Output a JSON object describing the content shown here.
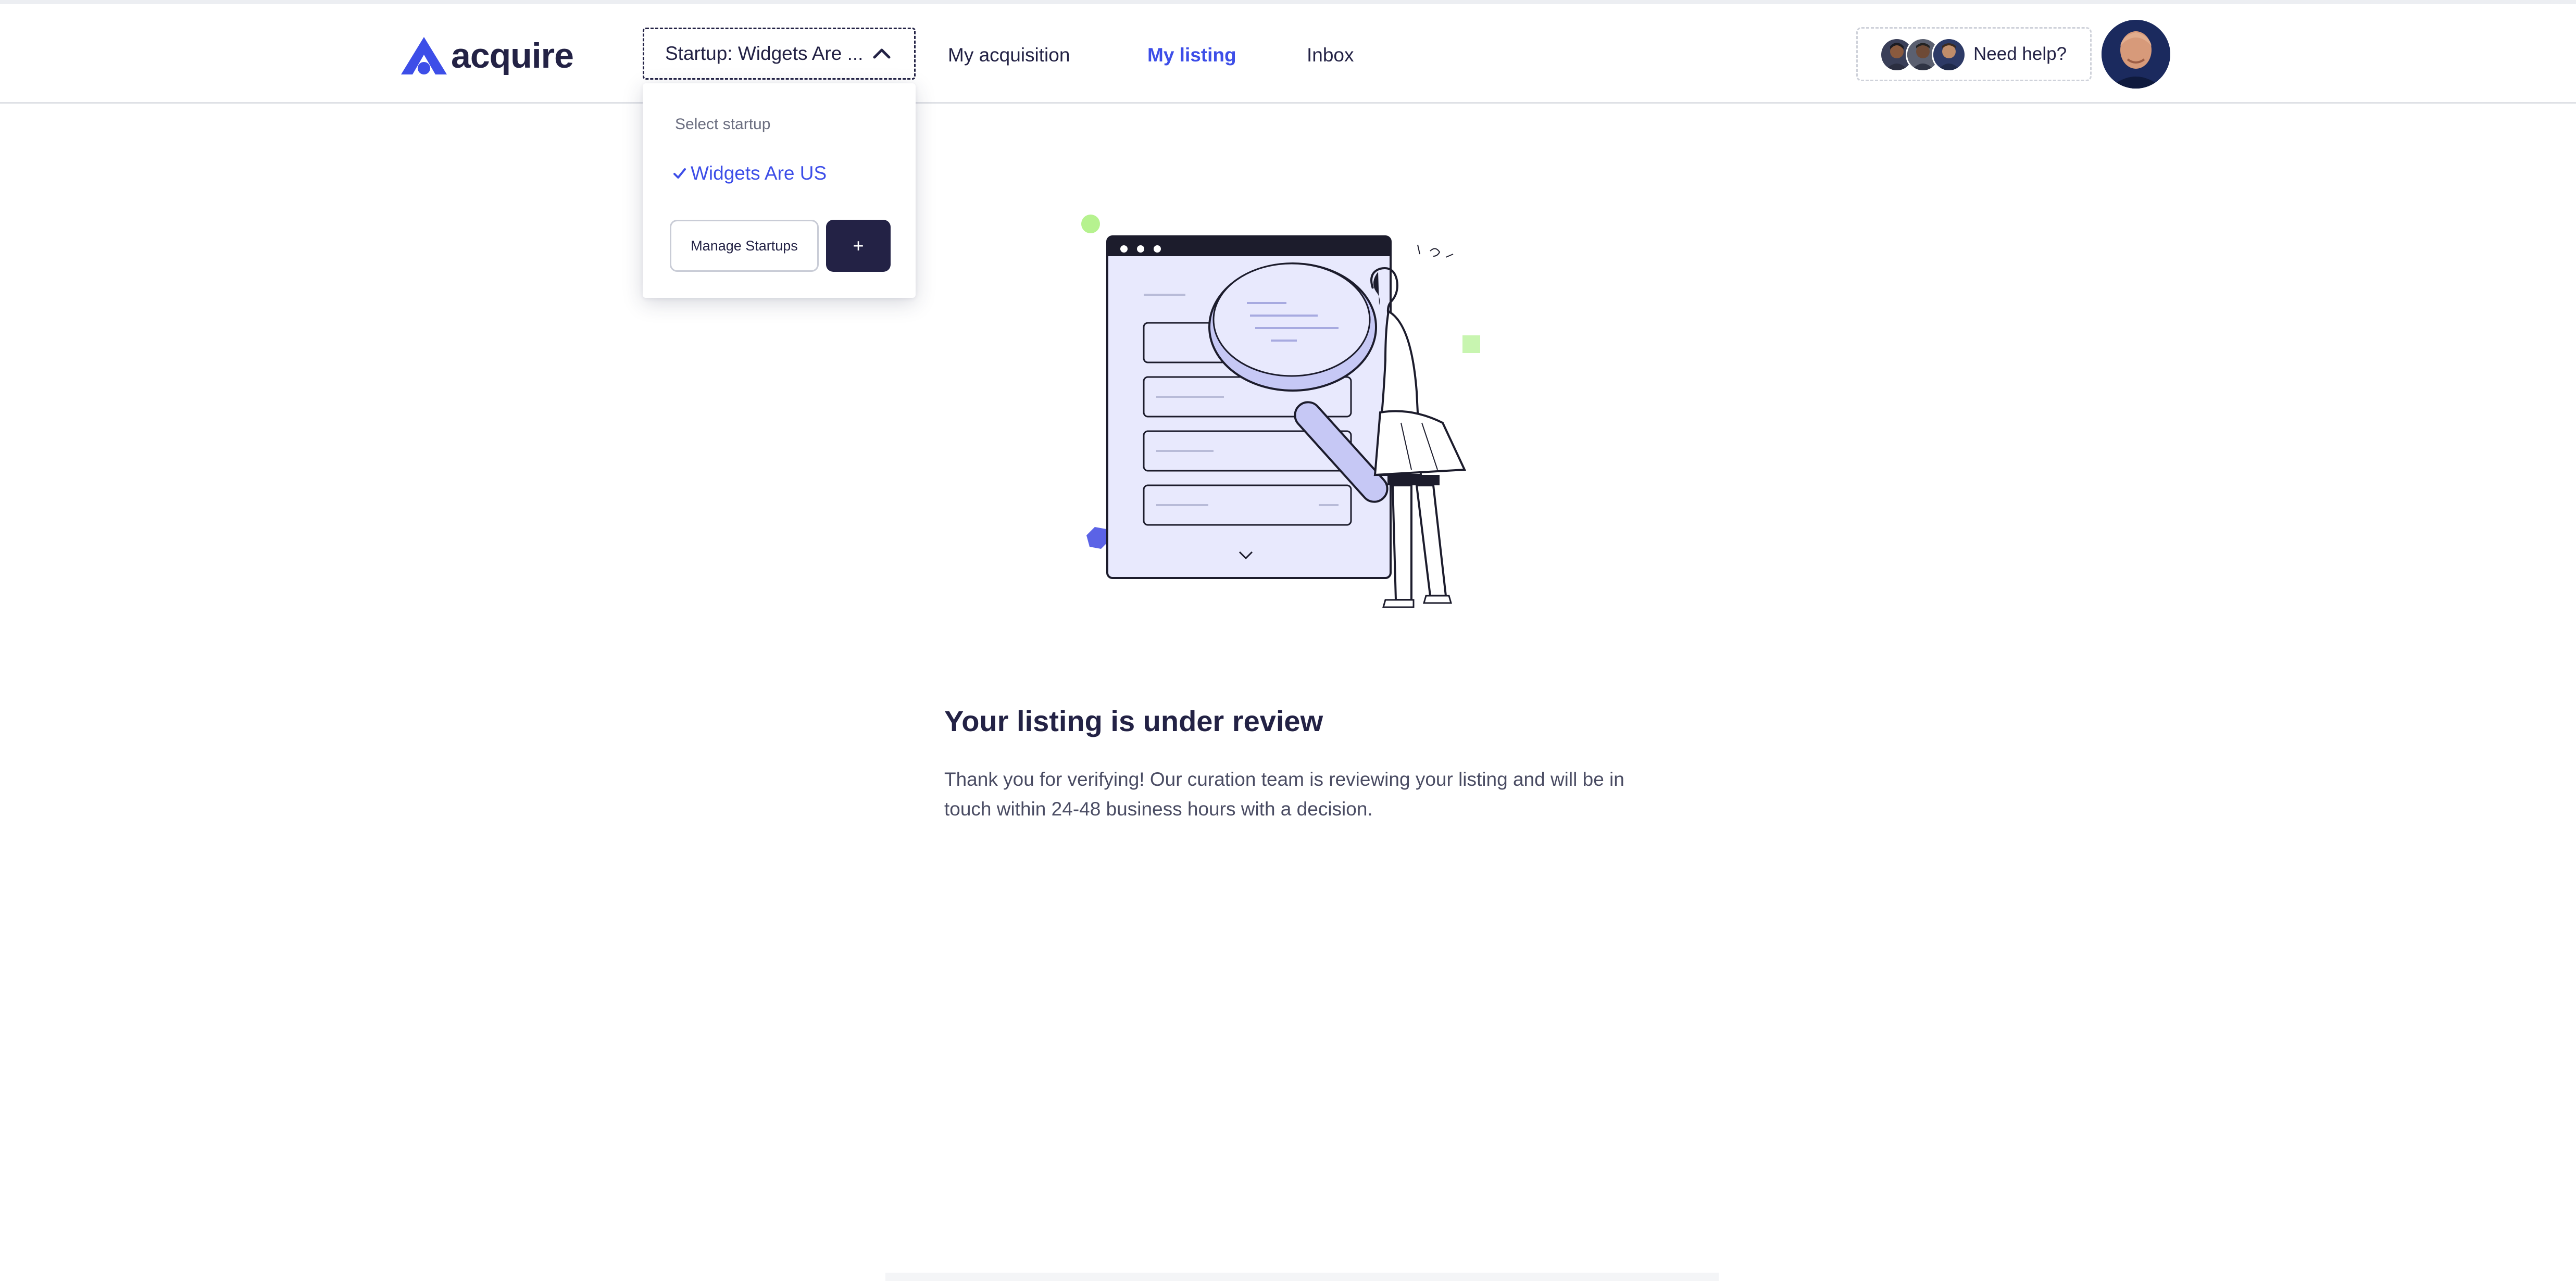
{
  "brand": {
    "name": "acquire",
    "color": "#3d4ee8"
  },
  "header": {
    "startup_select": {
      "label": "Startup: Widgets Are ...",
      "icon": "chevron-up-icon"
    },
    "nav": [
      {
        "label": "My acquisition",
        "active": false
      },
      {
        "label": "My listing",
        "active": true
      },
      {
        "label": "Inbox",
        "active": false
      }
    ],
    "help": {
      "label": "Need help?"
    }
  },
  "dropdown": {
    "heading": "Select startup",
    "selected_option": "Widgets Are US",
    "manage_label": "Manage Startups",
    "add_label": "+"
  },
  "main": {
    "title": "Your listing is under review",
    "body": "Thank you for verifying! Our curation team is reviewing your listing and will be in touch within 24-48 business hours with a decision."
  },
  "colors": {
    "accent": "#3d4ee8",
    "dark": "#232245",
    "illustration_fill": "#e8e9fd",
    "illustration_purple": "#c6c8f5",
    "green": "#b6f28f"
  }
}
